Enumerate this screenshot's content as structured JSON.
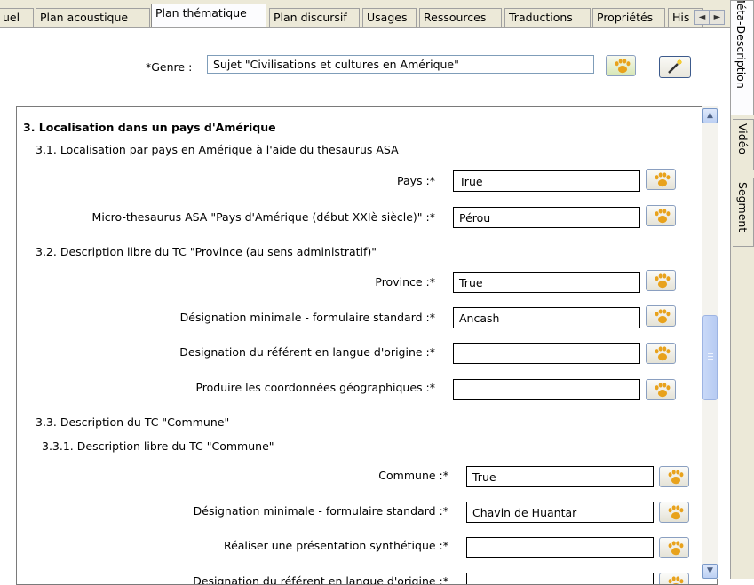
{
  "tabs": [
    {
      "label": "uel"
    },
    {
      "label": "Plan acoustique"
    },
    {
      "label": "Plan thématique"
    },
    {
      "label": "Plan discursif"
    },
    {
      "label": "Usages"
    },
    {
      "label": "Ressources"
    },
    {
      "label": "Traductions"
    },
    {
      "label": "Propriétés"
    },
    {
      "label": "His"
    }
  ],
  "tab_nav": {
    "left": "◄",
    "right": "►"
  },
  "side_tabs": [
    {
      "label": "Méta-Description"
    },
    {
      "label": "Vidéo"
    },
    {
      "label": "Segment"
    }
  ],
  "genre": {
    "label": "*Genre :",
    "value": "Sujet \"Civilisations et cultures en Amérique\""
  },
  "section3": {
    "title": "3. Localisation dans un pays d'Amérique"
  },
  "s31": {
    "title": "3.1. Localisation par pays en Amérique à l'aide du thesaurus ASA",
    "pays": {
      "label": "Pays :*",
      "value": "True"
    },
    "micro": {
      "label": "Micro-thesaurus ASA \"Pays d'Amérique (début XXIè siècle)\" :*",
      "value": "Pérou"
    }
  },
  "s32": {
    "title": "3.2. Description libre du TC \"Province (au sens administratif)\"",
    "province": {
      "label": "Province :*",
      "value": "True"
    },
    "designation": {
      "label": "Désignation minimale - formulaire standard :*",
      "value": "Ancash"
    },
    "referent": {
      "label": "Designation du référent en langue d'origine :*",
      "value": ""
    },
    "coords": {
      "label": "Produire les coordonnées géographiques :*",
      "value": ""
    }
  },
  "s33": {
    "title": "3.3. Description du TC \"Commune\"",
    "sub": "3.3.1. Description libre du TC \"Commune\"",
    "commune": {
      "label": "Commune :*",
      "value": "True"
    },
    "designation": {
      "label": "Désignation minimale - formulaire standard :*",
      "value": "Chavin de Huantar"
    },
    "synth": {
      "label": "Réaliser une présentation synthétique :*",
      "value": ""
    },
    "referent": {
      "label": "Designation du référent en langue d'origine :*",
      "value": ""
    }
  },
  "scrollbar": {
    "up": "▲",
    "down": "▼"
  },
  "colors": {
    "paw": "#e8a21c",
    "tab_bg": "#ece9d8",
    "field_border": "#000000"
  }
}
